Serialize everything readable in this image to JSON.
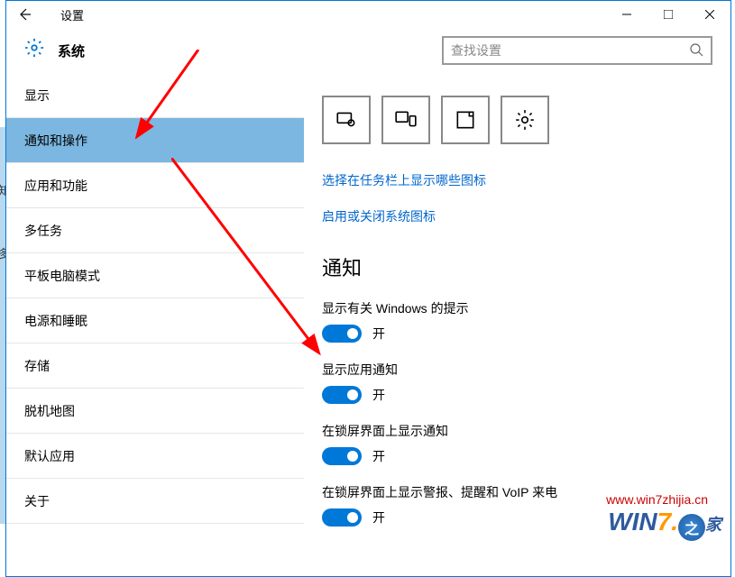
{
  "window": {
    "title": "设置"
  },
  "header": {
    "section": "系统",
    "search_placeholder": "查找设置"
  },
  "sidebar": {
    "items": [
      "显示",
      "通知和操作",
      "应用和功能",
      "多任务",
      "平板电脑模式",
      "电源和睡眠",
      "存储",
      "脱机地图",
      "默认应用",
      "关于"
    ],
    "active_index": 1
  },
  "main": {
    "links": [
      "选择在任务栏上显示哪些图标",
      "启用或关闭系统图标"
    ],
    "section_title": "通知",
    "settings": [
      {
        "label": "显示有关 Windows 的提示",
        "state": "开"
      },
      {
        "label": "显示应用通知",
        "state": "开"
      },
      {
        "label": "在锁屏界面上显示通知",
        "state": "开"
      },
      {
        "label": "在锁屏界面上显示警报、提醒和 VoIP 来电",
        "state": "开"
      }
    ]
  },
  "watermark": {
    "url": "www.win7zhijia.cn",
    "logo_parts": {
      "w": "W",
      "in": "IN",
      "seven": "7.",
      "jia": "家"
    }
  },
  "left_edge": {
    "chars": [
      "知",
      "多"
    ]
  }
}
